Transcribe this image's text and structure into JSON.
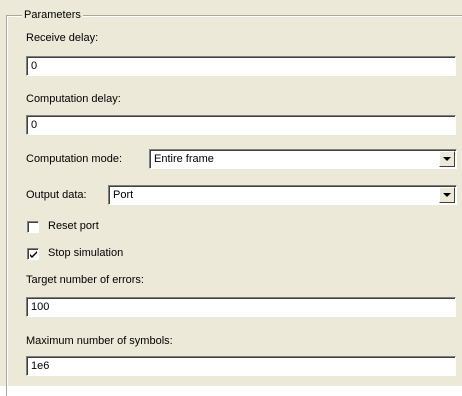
{
  "group": {
    "title": "Parameters"
  },
  "fields": {
    "receive_delay": {
      "label": "Receive delay:",
      "value": "0"
    },
    "computation_delay": {
      "label": "Computation delay:",
      "value": "0"
    },
    "computation_mode": {
      "label": "Computation mode:",
      "selected": "Entire frame"
    },
    "output_data": {
      "label": "Output data:",
      "selected": "Port"
    },
    "reset_port": {
      "label": "Reset port",
      "checked": false
    },
    "stop_simulation": {
      "label": "Stop simulation",
      "checked": true
    },
    "target_errors": {
      "label": "Target number of errors:",
      "value": "100"
    },
    "max_symbols": {
      "label": "Maximum number of symbols:",
      "value": "1e6"
    }
  },
  "icons": {
    "dropdown": "chevron-down-icon",
    "check": "checkmark-icon"
  }
}
